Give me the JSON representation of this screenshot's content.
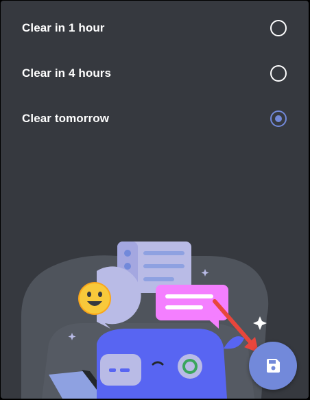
{
  "options": [
    {
      "label": "Clear in 1 hour",
      "selected": false
    },
    {
      "label": "Clear in 4 hours",
      "selected": false
    },
    {
      "label": "Clear tomorrow",
      "selected": true
    }
  ],
  "icons": {
    "radio": "radio-icon",
    "save": "save-icon",
    "illustration": "chat-illustration",
    "arrow": "annotation-arrow"
  },
  "colors": {
    "background": "#36393f",
    "accent": "#7289da",
    "text": "#ffffff",
    "arrow": "#e8463c"
  }
}
